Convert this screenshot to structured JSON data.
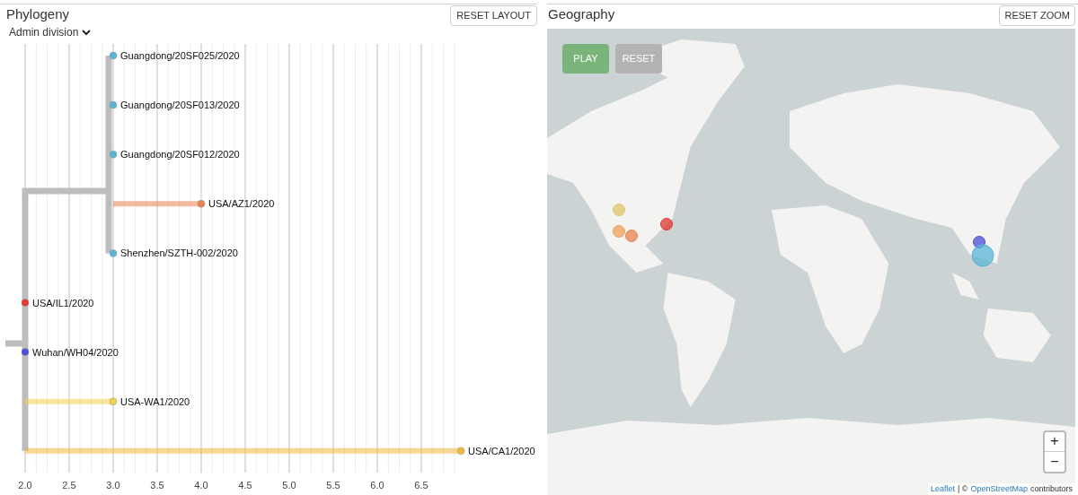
{
  "phylogeny": {
    "title": "Phylogeny",
    "reset_button": "RESET LAYOUT",
    "color_by": "Admin division",
    "tips": [
      {
        "label": "Guangdong/20SF025/2020",
        "color": "#5ab4d6"
      },
      {
        "label": "Guangdong/20SF013/2020",
        "color": "#5ab4d6"
      },
      {
        "label": "Guangdong/20SF012/2020",
        "color": "#5ab4d6"
      },
      {
        "label": "USA/AZ1/2020",
        "color": "#e8834f"
      },
      {
        "label": "Shenzhen/SZTH-002/2020",
        "color": "#5ab4d6"
      },
      {
        "label": "USA/IL1/2020",
        "color": "#e03a2f"
      },
      {
        "label": "Wuhan/WH04/2020",
        "color": "#4a4fd6"
      },
      {
        "label": "USA-WA1/2020",
        "color": "#f2d24a"
      },
      {
        "label": "USA/CA1/2020",
        "color": "#f0b83a"
      }
    ],
    "axis_ticks": [
      "2.0",
      "2.5",
      "3.0",
      "3.5",
      "4.0",
      "4.5",
      "5.0",
      "5.5",
      "6.0",
      "6.5"
    ]
  },
  "geography": {
    "title": "Geography",
    "reset_button": "RESET ZOOM",
    "play_button": "PLAY",
    "reset_map_button": "RESET",
    "markers": [
      {
        "color": "#e2c66a"
      },
      {
        "color": "#eda159"
      },
      {
        "color": "#e8834f"
      },
      {
        "color": "#e03a2f"
      },
      {
        "color": "#4a4fd6"
      },
      {
        "color": "#5ab4d6"
      }
    ],
    "zoom_in": "+",
    "zoom_out": "−",
    "attribution": {
      "leaflet": "Leaflet",
      "separator": "| ©",
      "osm": "OpenStreetMap",
      "suffix": "contributors"
    }
  }
}
